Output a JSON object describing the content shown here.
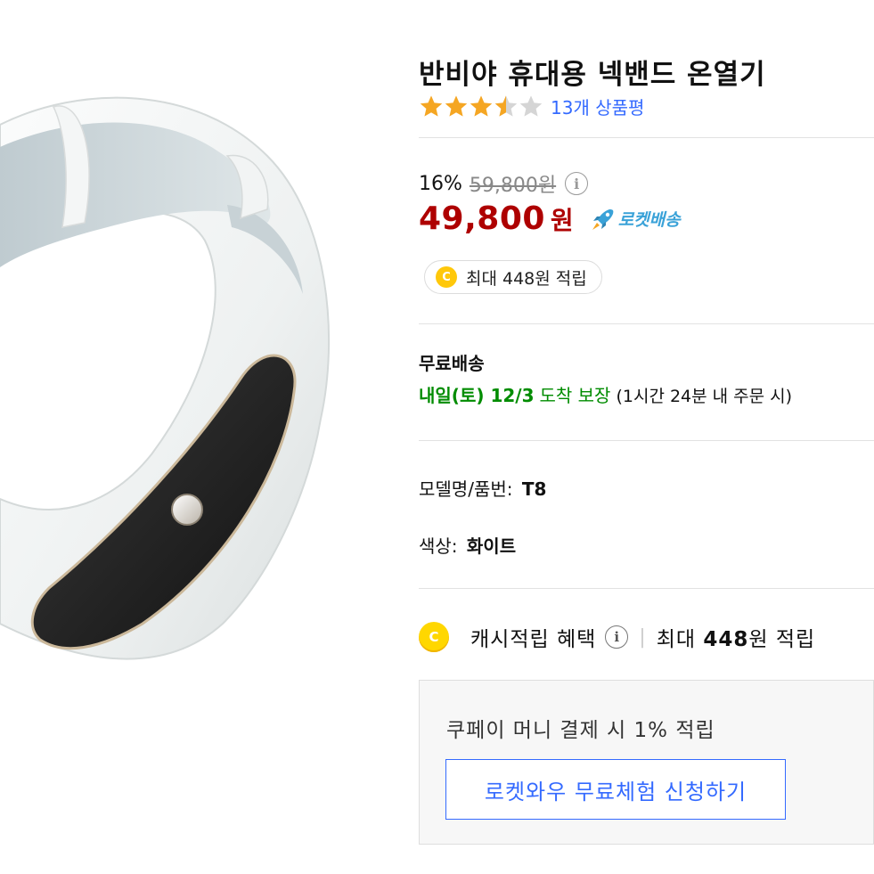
{
  "product": {
    "title": "반비야 휴대용 넥밴드 온열기",
    "image_alt": "white neckband heater product photo"
  },
  "rating": {
    "stars": 3.5,
    "max_stars": 5,
    "review_link": "13개 상품평"
  },
  "price": {
    "discount_rate": "16%",
    "original_price": "59,800원",
    "sale_price": "49,800",
    "currency": "원",
    "delivery_badge": "로켓배송",
    "cash_pill_icon": "C",
    "cash_pill_text": "최대 448원 적립"
  },
  "shipping": {
    "title": "무료배송",
    "date": "내일(토) 12/3",
    "guarantee": "도착 보장",
    "note": "(1시간 24분 내 주문 시)"
  },
  "specs": {
    "model_label": "모델명/품번:",
    "model_value": "T8",
    "color_label": "색상:",
    "color_value": "화이트"
  },
  "benefit": {
    "icon": "C",
    "label": "캐시적립 혜택",
    "info_icon": "i",
    "separator": "|",
    "max_prefix": "최대",
    "max_amount": "448",
    "max_suffix": "원 적립"
  },
  "coupay": {
    "text": "쿠페이 머니 결제 시 1% 적립",
    "button_label": "로켓와우 무료체험 신청하기"
  },
  "icons": {
    "price_info": "i"
  },
  "colors": {
    "sale_red": "#ae0000",
    "link_blue": "#346aff",
    "ship_green": "#008c00",
    "star": "#f5a623",
    "coin": "#ffc80a"
  }
}
